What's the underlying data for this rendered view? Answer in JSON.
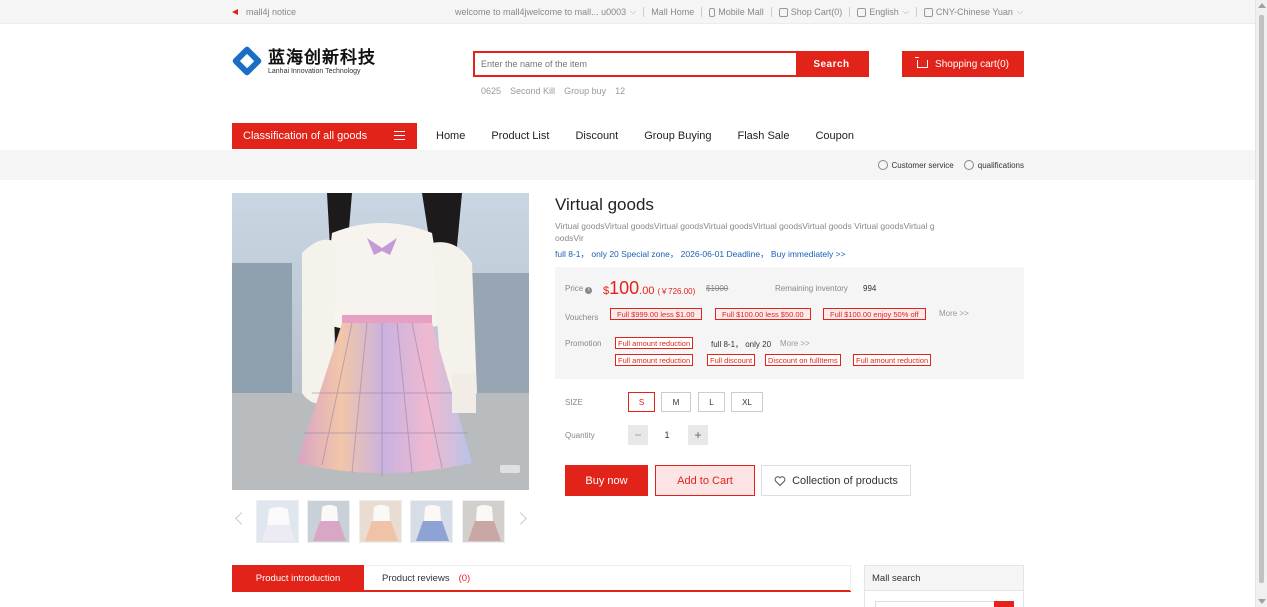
{
  "topbar": {
    "notice": "mall4j notice",
    "welcome": "welcome to mall4jwelcome to mall... u0003",
    "mall_home": "Mall Home",
    "mobile_mall": "Mobile Mall",
    "shop_cart": "Shop Cart(0)",
    "language": "English",
    "currency": "CNY-Chinese Yuan"
  },
  "header": {
    "logo_cn": "蓝海创新科技",
    "logo_en": "Lanhai Innovation Technology",
    "search_placeholder": "Enter the name of the item",
    "search_button": "Search",
    "hot_words": [
      "0625",
      "Second Kill",
      "Group buy",
      "12"
    ],
    "cart_button": "Shopping cart(0)"
  },
  "nav": {
    "category": "Classification of all goods",
    "links": [
      "Home",
      "Product List",
      "Discount",
      "Group Buying",
      "Flash Sale",
      "Coupon"
    ]
  },
  "servicebar": {
    "customer_service": "Customer service",
    "qualifications": "qualifications"
  },
  "product": {
    "title": "Virtual goods",
    "subtitle": "Virtual goodsVirtual goodsVirtual goodsVirtual goodsVirtual goodsVirtual goods Virtual goodsVirtual goodsVir",
    "promo_line": "full 8-1， only 20 Special zone， 2026-06-01 Deadline， Buy immediately >>",
    "price_label": "Price",
    "currency_symbol": "$",
    "price_int": "100",
    "price_dec": ".00",
    "price_converted": "(￥726.00)",
    "price_original": "$1000",
    "inventory_label": "Remaining inventory",
    "inventory_value": "994",
    "vouchers_label": "Vouchers",
    "vouchers": [
      "Full $999.00 less $1.00",
      "Full $100.00 less $50.00",
      "Full $100.00 enjoy 50% off"
    ],
    "more": "More >>",
    "promotion_label": "Promotion",
    "promotion_tag": "Full amount reduction",
    "promotion_text": "full 8-1， only 20",
    "promotion_tags": [
      "Full amount reduction",
      "Full discount",
      "Discount on fullItems",
      "Full amount reduction"
    ],
    "size_label": "SIZE",
    "sizes": [
      "S",
      "M",
      "L",
      "XL"
    ],
    "selected_size": "S",
    "quantity_label": "Quantity",
    "quantity": "1",
    "qty_minus": "−",
    "qty_plus": "+",
    "buy_now": "Buy now",
    "add_to_cart": "Add to Cart",
    "collect": "Collection of products"
  },
  "tabs": {
    "intro": "Product introduction",
    "reviews": "Product reviews",
    "reviews_count": "(0)"
  },
  "sidebar": {
    "mall_search": "Mall search"
  },
  "colors": {
    "brand_red": "#e2231a",
    "link_blue": "#1a5fb4",
    "logo_blue": "#1a6fc4"
  }
}
